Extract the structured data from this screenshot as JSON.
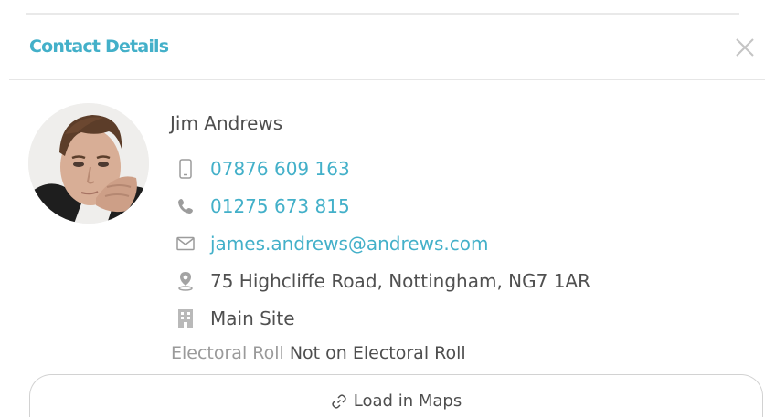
{
  "dialog": {
    "title": "Contact Details",
    "close_icon": "close-icon"
  },
  "contact": {
    "avatar_icon": "avatar-photo",
    "name": "Jim Andrews",
    "mobile": {
      "icon": "mobile-phone-icon",
      "value": "07876 609 163"
    },
    "phone": {
      "icon": "phone-handset-icon",
      "value": "01275 673 815"
    },
    "email": {
      "icon": "envelope-icon",
      "value": "james.andrews@andrews.com"
    },
    "address": {
      "icon": "location-pin-icon",
      "value": "75 Highcliffe Road, Nottingham, NG7 1AR"
    },
    "site": {
      "icon": "building-icon",
      "value": "Main Site"
    },
    "electoral_roll": {
      "label": "Electoral Roll",
      "value": "Not on Electoral Roll"
    }
  },
  "actions": {
    "maps_icon": "link-icon",
    "maps_label": "Load in Maps"
  },
  "colors": {
    "accent": "#43b0c9",
    "muted_label": "#9a9a9a",
    "text": "#4e4e4e"
  }
}
